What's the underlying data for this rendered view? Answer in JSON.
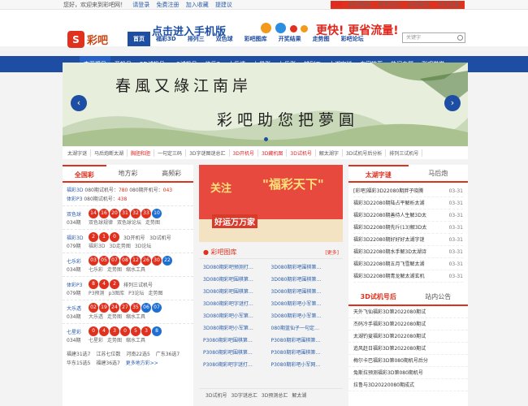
{
  "topbar": {
    "welcome": "您好，欢迎来到彩吧网！",
    "login": "请登录",
    "register": "免费注册",
    "favorite": "加入收藏",
    "feedback": "提建议",
    "right_links": [
      "彩吧",
      "彩吧图库",
      "彩吧论坛",
      "彩吧助手",
      "开奖结果"
    ]
  },
  "logo": {
    "text": "彩吧",
    "badge": "S"
  },
  "banner": {
    "text1": "点击进入手机版",
    "text2": "更快! 更省流量!"
  },
  "nav1": [
    "首页",
    "福彩3D",
    "排列三",
    "双色球",
    "彩吧图库",
    "开奖结果",
    "走势图",
    "彩吧论坛"
  ],
  "search": {
    "placeholder": "关键字"
  },
  "nav2": [
    "查开奖号",
    "开机号",
    "3D试机号",
    "p3试机号",
    "快乐8",
    "大乐透",
    "七星彩",
    "七乐彩",
    "排列五",
    "太湖字谜",
    "专家推荐",
    "热门专题",
    "彩吧学堂"
  ],
  "hero": {
    "line1": "春風又綠江南岸",
    "line2": "彩吧助您把夢圓",
    "prev": "‹",
    "next": "›"
  },
  "quick": [
    "太湖字谜",
    "马后炮断太湖",
    "胸胆和胆",
    "一句定三码",
    "3D字谜图谜总汇",
    "3D开机号",
    "3D藏机图",
    "3D试机号",
    "解太湖字",
    "3D试机号后分析",
    "排列三试机号"
  ],
  "left": {
    "tabs": [
      "全国彩",
      "地方彩",
      "高频彩"
    ],
    "info1": {
      "label": "福彩3D",
      "text": "080期试机号：",
      "v1": "780",
      "text2": "080期开机号：",
      "v2": "043"
    },
    "info2": {
      "label": "体彩P3",
      "text": "080期试机号：",
      "v1": "438"
    },
    "games": [
      {
        "name": "双色球",
        "period": "034期",
        "reds": [
          "14",
          "16",
          "20",
          "31",
          "32",
          "33"
        ],
        "blues": [
          "10"
        ],
        "links": [
          "双色球规律",
          "双色球论坛",
          "走势图"
        ]
      },
      {
        "name": "福彩3D",
        "period": "079期",
        "reds": [
          "2",
          "1",
          "0"
        ],
        "blues": [],
        "extra": "3D开机号   3D试机号",
        "links": [
          "福彩3D",
          "3D走势图",
          "3D论坛"
        ]
      },
      {
        "name": "七乐彩",
        "period": "034期",
        "reds": [
          "03",
          "05",
          "07",
          "08",
          "12",
          "26",
          "30"
        ],
        "blues": [
          "22"
        ],
        "links": [
          "七乐彩",
          "走势图",
          "缩水工具"
        ]
      },
      {
        "name": "体彩P3",
        "period": "079期",
        "reds": [
          "8",
          "4",
          "2"
        ],
        "blues": [],
        "extra": "排列三试机号",
        "links": [
          "P3预测",
          "p3图库",
          "P3论坛",
          "走势图"
        ]
      },
      {
        "name": "大乐透",
        "period": "034期",
        "reds": [
          "02",
          "19",
          "24",
          "27",
          "35"
        ],
        "blues": [
          "06",
          "07"
        ],
        "links": [
          "大乐透",
          "走势图",
          "缩水工具"
        ]
      },
      {
        "name": "七星彩",
        "period": "034期",
        "reds": [
          "0",
          "4",
          "3",
          "0",
          "5",
          "3"
        ],
        "blues": [
          "8"
        ],
        "links": [
          "七星彩",
          "走势图",
          "缩水工具"
        ]
      }
    ],
    "footer": [
      "福建31选7",
      "江苏七位数",
      "河南22选5",
      "广东36选7",
      "华东15选5",
      "福建36选7",
      "更多地方彩>>"
    ]
  },
  "poster": {
    "t1": "关注",
    "t2": "\"福彩天下\"",
    "t3": "好运万万家"
  },
  "library": {
    "title": "彩吧图库",
    "more": "[更多]",
    "items": [
      "3D080期彩吧预测打…",
      "3D080期彩吧围棋第…",
      "3D080期彩吧围棋第…",
      "3D080期彩吧围棋第…",
      "3D080期彩吧围棋第…",
      "3D080期彩吧围棋第…",
      "3D080期彩吧字谜打…",
      "3D080期彩吧小军第…",
      "3D080期彩吧小军第…",
      "3D080期彩吧小军第…",
      "3D080期彩吧小军第…",
      "080期蓝仙子一句定…",
      "P3080期彩吧围棋第…",
      "P3080期彩吧围棋第…",
      "P3080期彩吧围棋第…",
      "P3080期彩吧围棋第…",
      "P3080期彩吧字谜打…",
      "P3080期彩吧小军网…"
    ]
  },
  "midfoot": [
    "3D试机号",
    "3D字谜总汇",
    "3D预测总汇",
    "解太湖"
  ],
  "right": {
    "tabs": [
      "太湖字谜",
      "马后炮"
    ],
    "news": [
      {
        "t": "[彩吧]福彩3D22080期胖子晓腾",
        "d": "03-31"
      },
      {
        "t": "福彩3D22080期陆占平解析太湖",
        "d": "03-31"
      },
      {
        "t": "福彩3D22080期善待人生解3D太",
        "d": "03-31"
      },
      {
        "t": "福彩3D22080期先斤(13)解3D太",
        "d": "03-31"
      },
      {
        "t": "福彩3D22080期好好好太湖字谜",
        "d": "03-31"
      },
      {
        "t": "福彩3D22080期水手解3D太湖诗",
        "d": "03-31"
      },
      {
        "t": "福彩3D22080期五月飞雪解太湖",
        "d": "03-31"
      },
      {
        "t": "福彩3D22080期青龙解太湖玄机",
        "d": "03-31"
      }
    ],
    "tabs2": [
      "3D试机号后",
      "站内公告"
    ],
    "news2": [
      "天外飞仙福彩3D第2022080期试",
      "杰码冷手福彩3D第2022080期试",
      "太湖钓叟福彩3D第2022080期试",
      "追风赶日福彩3D第2022080期试",
      "梅尔卡巴福彩3D第080期机号后分",
      "兔斯拉预测福彩3D第080期机号",
      "拉鲁与3D20220080期成式"
    ]
  }
}
